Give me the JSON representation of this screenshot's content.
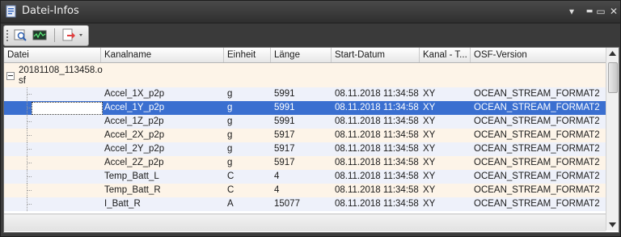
{
  "window": {
    "title": "Datei-Infos",
    "buttons": {
      "pin": "▾",
      "minimize": "▬",
      "maximize": "▭",
      "close": "✕"
    }
  },
  "toolbar": {
    "items": [
      {
        "name": "preview-icon"
      },
      {
        "name": "signal-view-icon"
      },
      {
        "name": "export-dropdown-icon"
      }
    ]
  },
  "grid": {
    "columns": [
      "Datei",
      "Kanalname",
      "Einheit",
      "Länge",
      "Start-Datum",
      "Kanal - T...",
      "OSF-Version"
    ],
    "parent": {
      "datei": "20181108_113458.osf"
    },
    "rows": [
      {
        "kanalname": "Accel_1X_p2p",
        "einheit": "g",
        "laenge": "5991",
        "start": "08.11.2018 11:34:58",
        "kanal_t": "XY",
        "osf": "OCEAN_STREAM_FORMAT2",
        "selected": false
      },
      {
        "kanalname": "Accel_1Y_p2p",
        "einheit": "g",
        "laenge": "5991",
        "start": "08.11.2018 11:34:58",
        "kanal_t": "XY",
        "osf": "OCEAN_STREAM_FORMAT2",
        "selected": true
      },
      {
        "kanalname": "Accel_1Z_p2p",
        "einheit": "g",
        "laenge": "5991",
        "start": "08.11.2018 11:34:58",
        "kanal_t": "XY",
        "osf": "OCEAN_STREAM_FORMAT2",
        "selected": false
      },
      {
        "kanalname": "Accel_2X_p2p",
        "einheit": "g",
        "laenge": "5917",
        "start": "08.11.2018 11:34:58",
        "kanal_t": "XY",
        "osf": "OCEAN_STREAM_FORMAT2",
        "selected": false
      },
      {
        "kanalname": "Accel_2Y_p2p",
        "einheit": "g",
        "laenge": "5917",
        "start": "08.11.2018 11:34:58",
        "kanal_t": "XY",
        "osf": "OCEAN_STREAM_FORMAT2",
        "selected": false
      },
      {
        "kanalname": "Accel_2Z_p2p",
        "einheit": "g",
        "laenge": "5917",
        "start": "08.11.2018 11:34:58",
        "kanal_t": "XY",
        "osf": "OCEAN_STREAM_FORMAT2",
        "selected": false
      },
      {
        "kanalname": "Temp_Batt_L",
        "einheit": "C",
        "laenge": "4",
        "start": "08.11.2018 11:34:58",
        "kanal_t": "XY",
        "osf": "OCEAN_STREAM_FORMAT2",
        "selected": false
      },
      {
        "kanalname": "Temp_Batt_R",
        "einheit": "C",
        "laenge": "4",
        "start": "08.11.2018 11:34:58",
        "kanal_t": "XY",
        "osf": "OCEAN_STREAM_FORMAT2",
        "selected": false
      },
      {
        "kanalname": "I_Batt_R",
        "einheit": "A",
        "laenge": "15077",
        "start": "08.11.2018 11:34:58",
        "kanal_t": "XY",
        "osf": "OCEAN_STREAM_FORMAT2",
        "selected": false
      }
    ]
  },
  "colors": {
    "selection": "#3a6fd0",
    "row_even": "#fdf4e8",
    "row_odd": "#eef1fa",
    "chrome": "#3c3c3c"
  }
}
